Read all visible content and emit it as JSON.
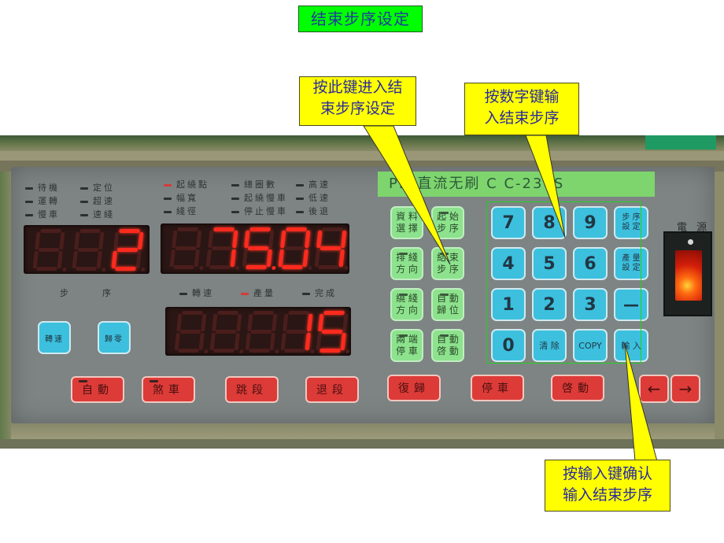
{
  "title": "结束步序设定",
  "callouts": [
    {
      "id": "enter-end-step",
      "lines": [
        "按此键进入结",
        "束步序设定"
      ]
    },
    {
      "id": "numeric-keys",
      "lines": [
        "按数字键输",
        "入结束步序"
      ]
    },
    {
      "id": "confirm-input",
      "lines": [
        "按输入键确认",
        "输入结束步序"
      ]
    }
  ],
  "device": {
    "model_lcd": "PD 直流无刷 C C-230S",
    "power_label": "電 源",
    "power_state": "on",
    "indicators_left": [
      {
        "label": "待機",
        "lit": false
      },
      {
        "label": "定位",
        "lit": false
      },
      {
        "label": "運轉",
        "lit": false
      },
      {
        "label": "超速",
        "lit": false
      },
      {
        "label": "慢車",
        "lit": false
      },
      {
        "label": "速綫",
        "lit": false
      }
    ],
    "indicators_mid": [
      {
        "label": "起繞點",
        "lit": true
      },
      {
        "label": "總圈數",
        "lit": false
      },
      {
        "label": "高速",
        "lit": false
      },
      {
        "label": "幅寬",
        "lit": false
      },
      {
        "label": "起繞慢車",
        "lit": false
      },
      {
        "label": "低速",
        "lit": false
      },
      {
        "label": "綫徑",
        "lit": false
      },
      {
        "label": "停止慢車",
        "lit": false
      },
      {
        "label": "後退",
        "lit": false
      }
    ],
    "indicators_display3": [
      {
        "label": "轉速",
        "lit": false
      },
      {
        "label": "產量",
        "lit": true
      },
      {
        "label": "完成",
        "lit": false
      }
    ],
    "step_display": {
      "value": "2",
      "digits": 3
    },
    "step_label_left": "步",
    "step_label_right": "序",
    "main_display": {
      "value": "75.04",
      "digits": 5
    },
    "count_display": {
      "value": "15",
      "digits": 5
    },
    "left_blue_buttons": [
      "轉速",
      "歸零"
    ],
    "function_keys": [
      {
        "label_top": "資 料",
        "label_bottom": "選 擇",
        "bar": false
      },
      {
        "label_top": "起 始",
        "label_bottom": "步 序",
        "bar": true
      },
      {
        "label_top": "排 綫",
        "label_bottom": "方 向",
        "bar": true
      },
      {
        "label_top": "結 束",
        "label_bottom": "步 序",
        "bar": true
      },
      {
        "label_top": "繞 綫",
        "label_bottom": "方 向",
        "bar": true
      },
      {
        "label_top": "自 動",
        "label_bottom": "歸 位",
        "bar": true
      },
      {
        "label_top": "兩 端",
        "label_bottom": "停 車",
        "bar": true
      },
      {
        "label_top": "自 動",
        "label_bottom": "啓 動",
        "bar": true
      }
    ],
    "keypad": [
      [
        "7",
        "8",
        "9",
        "步 序|設 定"
      ],
      [
        "4",
        "5",
        "6",
        "產 量|設 定"
      ],
      [
        "1",
        "2",
        "3",
        "—"
      ],
      [
        "0",
        "清 除",
        "COPY",
        "輸 入"
      ]
    ],
    "bottom_buttons": [
      {
        "label": "自動",
        "bar": true
      },
      {
        "label": "煞車",
        "bar": true
      },
      {
        "label": "跳段",
        "bar": false
      },
      {
        "label": "退段",
        "bar": false
      },
      {
        "label": "復歸",
        "bar": false
      },
      {
        "label": "停車",
        "bar": false
      },
      {
        "label": "啓動",
        "bar": false
      }
    ],
    "arrow_buttons": [
      "←",
      "→"
    ]
  },
  "colors": {
    "title_bg": "#00ff00",
    "callout_bg": "#ffff00",
    "callout_text": "#2a2aa0",
    "led_on": "#ff2a1e",
    "keypad_blue": "#3cc0de",
    "function_green": "#8de28d",
    "action_red": "#dd3b38",
    "lcd_green": "#7ed56e"
  }
}
